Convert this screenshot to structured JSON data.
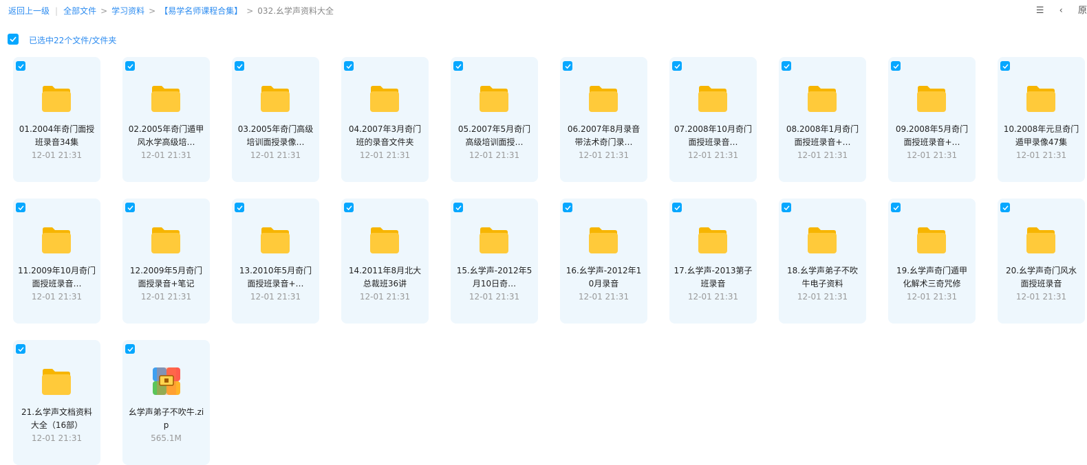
{
  "breadcrumb": {
    "back": "返回上一级",
    "items": [
      "全部文件",
      "学习资料",
      "【易学名师课程合集】"
    ],
    "current": "032.幺学声资料大全"
  },
  "toolbar": {
    "view_icon_glyph": "☰",
    "collapse_glyph": "‹",
    "more_glyph": "原"
  },
  "selection": {
    "text": "已选中22个文件/文件夹"
  },
  "files": [
    {
      "name": "01.2004年奇门面授班录音34集",
      "meta": "12-01 21:31",
      "type": "folder"
    },
    {
      "name": "02.2005年奇门遁甲风水学高级培…",
      "meta": "12-01 21:31",
      "type": "folder"
    },
    {
      "name": "03.2005年奇门高级培训面授录像…",
      "meta": "12-01 21:31",
      "type": "folder"
    },
    {
      "name": "04.2007年3月奇门班的录音文件夹",
      "meta": "12-01 21:31",
      "type": "folder"
    },
    {
      "name": "05.2007年5月奇门高级培训面授…",
      "meta": "12-01 21:31",
      "type": "folder"
    },
    {
      "name": "06.2007年8月录音带法术奇门录…",
      "meta": "12-01 21:31",
      "type": "folder"
    },
    {
      "name": "07.2008年10月奇门面授班录音…",
      "meta": "12-01 21:31",
      "type": "folder"
    },
    {
      "name": "08.2008年1月奇门面授班录音+…",
      "meta": "12-01 21:31",
      "type": "folder"
    },
    {
      "name": "09.2008年5月奇门面授班录音+…",
      "meta": "12-01 21:31",
      "type": "folder"
    },
    {
      "name": "10.2008年元旦奇门遁甲录像47集",
      "meta": "12-01 21:31",
      "type": "folder"
    },
    {
      "name": "11.2009年10月奇门面授班录音…",
      "meta": "12-01 21:31",
      "type": "folder"
    },
    {
      "name": "12.2009年5月奇门面授录音+笔记",
      "meta": "12-01 21:31",
      "type": "folder"
    },
    {
      "name": "13.2010年5月奇门面授班录音+…",
      "meta": "12-01 21:31",
      "type": "folder"
    },
    {
      "name": "14.2011年8月北大总裁班36讲",
      "meta": "12-01 21:31",
      "type": "folder"
    },
    {
      "name": "15.幺学声-2012年5月10日奇…",
      "meta": "12-01 21:31",
      "type": "folder"
    },
    {
      "name": "16.幺学声-2012年10月录音",
      "meta": "12-01 21:31",
      "type": "folder"
    },
    {
      "name": "17.幺学声-2013第子班录音",
      "meta": "12-01 21:31",
      "type": "folder"
    },
    {
      "name": "18.幺学声弟子不吹牛电子资料",
      "meta": "12-01 21:31",
      "type": "folder"
    },
    {
      "name": "19.幺学声奇门遁甲化解术三奇咒修",
      "meta": "12-01 21:31",
      "type": "folder"
    },
    {
      "name": "20.幺学声奇门风水面授班录音",
      "meta": "12-01 21:31",
      "type": "folder"
    },
    {
      "name": "21.幺学声文档资料大全（16部）",
      "meta": "12-01 21:31",
      "type": "folder"
    },
    {
      "name": "幺学声弟子不吹牛.zip",
      "meta": "565.1M",
      "type": "zip"
    }
  ],
  "colors": {
    "accent": "#06a7ff",
    "folder": "#ffca3a",
    "card_bg": "#eef7fd"
  }
}
